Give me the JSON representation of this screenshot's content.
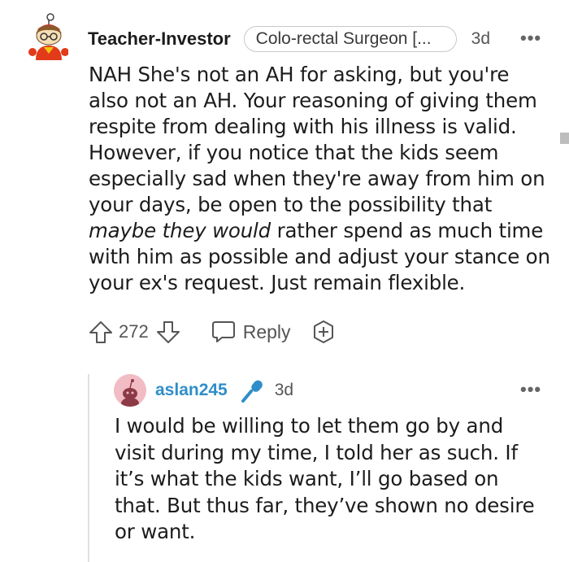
{
  "comment1": {
    "username": "Teacher-Investor",
    "flair": "Colo-rectal Surgeon [...",
    "time": "3d",
    "body_part1": "NAH She's not an AH for asking, but you're also not an AH. Your reasoning of giving them respite from dealing with his illness is valid. However, if you notice that the kids seem especially sad when they're away from him on your days, be open to the possibility that ",
    "body_italic": "maybe they would",
    "body_part2": " rather spend as much time with him as possible and adjust your stance on your ex's request. Just remain flexible.",
    "score": "272",
    "reply_label": "Reply",
    "more_label": "•••",
    "avatar_icon": "snoo-avatar-icon"
  },
  "comment2": {
    "username": "aslan245",
    "time": "3d",
    "body": "I would be willing to let them go by and visit during my time, I told her as such. If it’s what the kids want, I’ll go based on that. But thus far, they’ve shown no desire or want.",
    "more_label": "•••",
    "badge_icon": "microphone-icon",
    "badge_color": "#2f8ec9",
    "avatar_color": "#f2bcc4"
  }
}
